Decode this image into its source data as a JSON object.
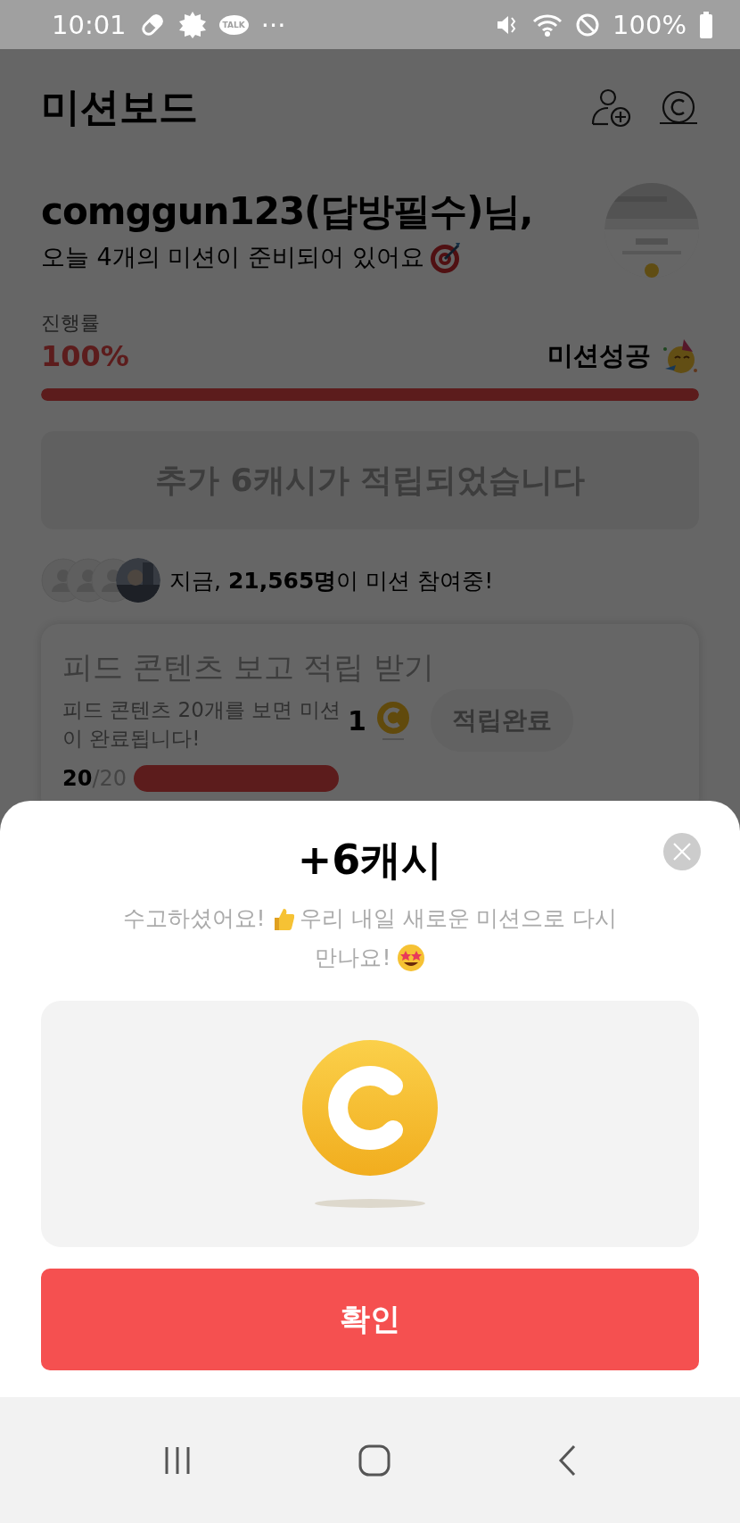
{
  "status_bar": {
    "time": "10:01",
    "talk_label": "TALK",
    "dots": "···",
    "battery": "100%"
  },
  "header": {
    "title": "미션보드"
  },
  "greeting": {
    "name": "comggun123(답방필수)님,",
    "subtitle": "오늘 4개의 미션이 준비되어 있어요"
  },
  "progress": {
    "label": "진행률",
    "value": "100%",
    "status": "미션성공",
    "level": 1
  },
  "notice": "추가 6캐시가 적립되었습니다",
  "participants": {
    "text": "지금, **21,565명**이 미션 참여중!"
  },
  "missions": [
    {
      "title": "피드 콘텐츠 보고 적립 받기",
      "description": "피드 콘텐츠 20개를 보면 미션이 완료됩니다!",
      "reward": "1",
      "button": "적립완료",
      "done": "20",
      "total": "/20",
      "level": 1
    }
  ],
  "modal": {
    "title": "+6캐시",
    "message_1": "수고하셨어요!",
    "message_2": "우리 내일 새로운 미션으로 다시",
    "message_3": "만나요!",
    "confirm": "확인"
  }
}
